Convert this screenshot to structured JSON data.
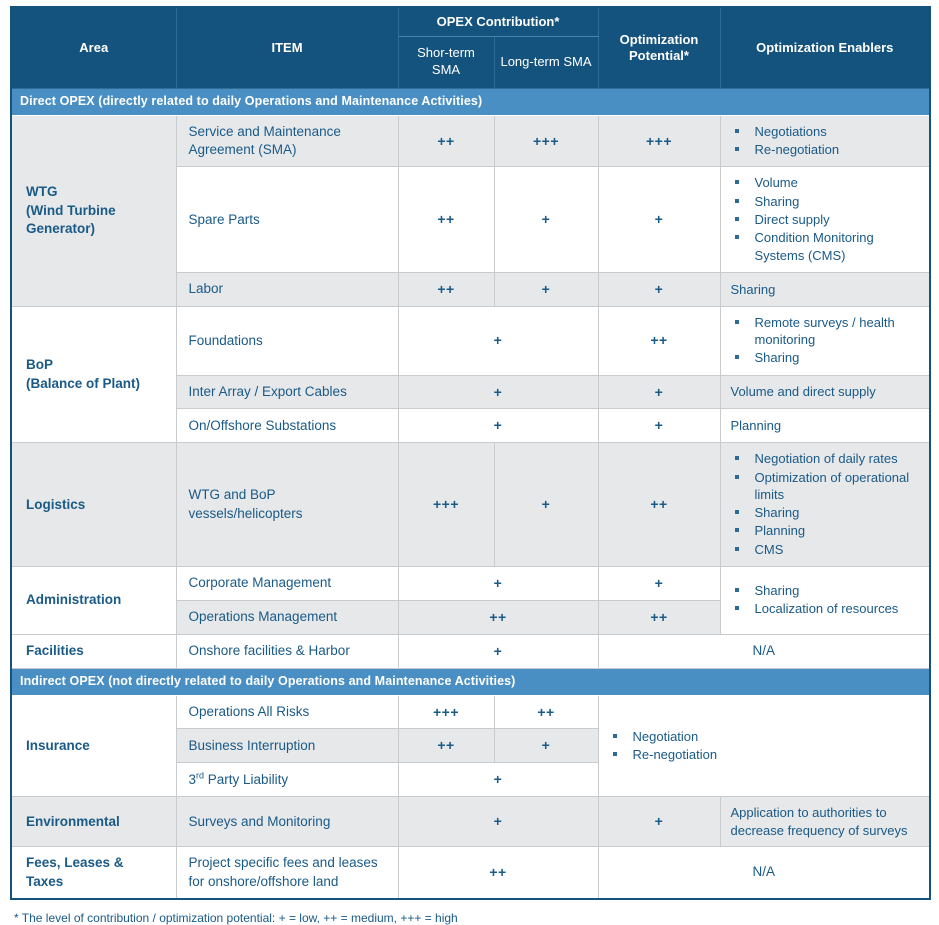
{
  "table": {
    "headers": {
      "area": "Area",
      "item": "ITEM",
      "opex_contribution": "OPEX Contribution*",
      "short_term": "Shor-term SMA",
      "long_term": "Long-term SMA",
      "optimization_potential": "Optimization Potential*",
      "optimization_enablers": "Optimization Enablers"
    },
    "sections": [
      {
        "band": "Direct OPEX (directly related to daily Operations and Maintenance Activities)",
        "areas": [
          {
            "name": "WTG (Wind Turbine Generator)",
            "rows": [
              {
                "item": "Service and Maintenance Agreement (SMA)",
                "short_term": "++",
                "long_term": "+++",
                "optimization_potential": "+++",
                "enablers": [
                  "Negotiations",
                  "Re-negotiation"
                ]
              },
              {
                "item": "Spare Parts",
                "short_term": "++",
                "long_term": "+",
                "optimization_potential": "+",
                "enablers": [
                  "Volume",
                  "Sharing",
                  "Direct supply",
                  "Condition Monitoring Systems (CMS)"
                ]
              },
              {
                "item": "Labor",
                "short_term": "++",
                "long_term": "+",
                "optimization_potential": "+",
                "enablers_text": "Sharing"
              }
            ]
          },
          {
            "name": "BoP (Balance of Plant)",
            "rows": [
              {
                "item": "Foundations",
                "contribution": "+",
                "optimization_potential": "++",
                "enablers": [
                  "Remote surveys / health monitoring",
                  "Sharing"
                ]
              },
              {
                "item": "Inter Array / Export Cables",
                "contribution": "+",
                "optimization_potential": "+",
                "enablers_text": "Volume and direct supply"
              },
              {
                "item": "On/Offshore Substations",
                "contribution": "+",
                "optimization_potential": "+",
                "enablers_text": "Planning"
              }
            ]
          },
          {
            "name": "Logistics",
            "rows": [
              {
                "item": "WTG and BoP vessels/helicopters",
                "short_term": "+++",
                "long_term": "+",
                "optimization_potential": "++",
                "enablers": [
                  "Negotiation of daily rates",
                  "Optimization of operational limits",
                  "Sharing",
                  "Planning",
                  "CMS"
                ]
              }
            ]
          },
          {
            "name": "Administration",
            "shared_enablers": [
              "Sharing",
              "Localization of resources"
            ],
            "rows": [
              {
                "item": "Corporate Management",
                "contribution": "+",
                "optimization_potential": "+"
              },
              {
                "item": "Operations Management",
                "contribution": "++",
                "optimization_potential": "++"
              }
            ]
          },
          {
            "name": "Facilities",
            "rows": [
              {
                "item": "Onshore facilities & Harbor",
                "contribution": "+",
                "merged_right": "N/A"
              }
            ]
          }
        ]
      },
      {
        "band": "Indirect OPEX (not directly related to daily Operations and Maintenance Activities)",
        "areas": [
          {
            "name": "Insurance",
            "shared_enablers": [
              "Negotiation",
              "Re-negotiation"
            ],
            "rows": [
              {
                "item": "Operations All Risks",
                "short_term": "+++",
                "long_term": "++"
              },
              {
                "item": "Business Interruption",
                "short_term": "++",
                "long_term": "+"
              },
              {
                "item_prefix": "3",
                "item_sup": "rd",
                "item_suffix": " Party Liability",
                "contribution": "+"
              }
            ]
          },
          {
            "name": "Environmental",
            "rows": [
              {
                "item": "Surveys and Monitoring",
                "contribution": "+",
                "optimization_potential": "+",
                "enablers_text": "Application to authorities to decrease frequency of surveys"
              }
            ]
          },
          {
            "name": "Fees, Leases & Taxes",
            "rows": [
              {
                "item": "Project specific fees and leases for onshore/offshore land",
                "contribution": "++",
                "merged_right": "N/A"
              }
            ]
          }
        ]
      }
    ]
  },
  "footnote": "* The level of contribution / optimization potential: + = low, ++ = medium, +++ = high",
  "colors": {
    "header_bg": "#14537e",
    "band_bg": "#4a8fc4",
    "text": "#1a5a87",
    "row_gray": "#e6e8ea",
    "border": "#c9ccce"
  }
}
